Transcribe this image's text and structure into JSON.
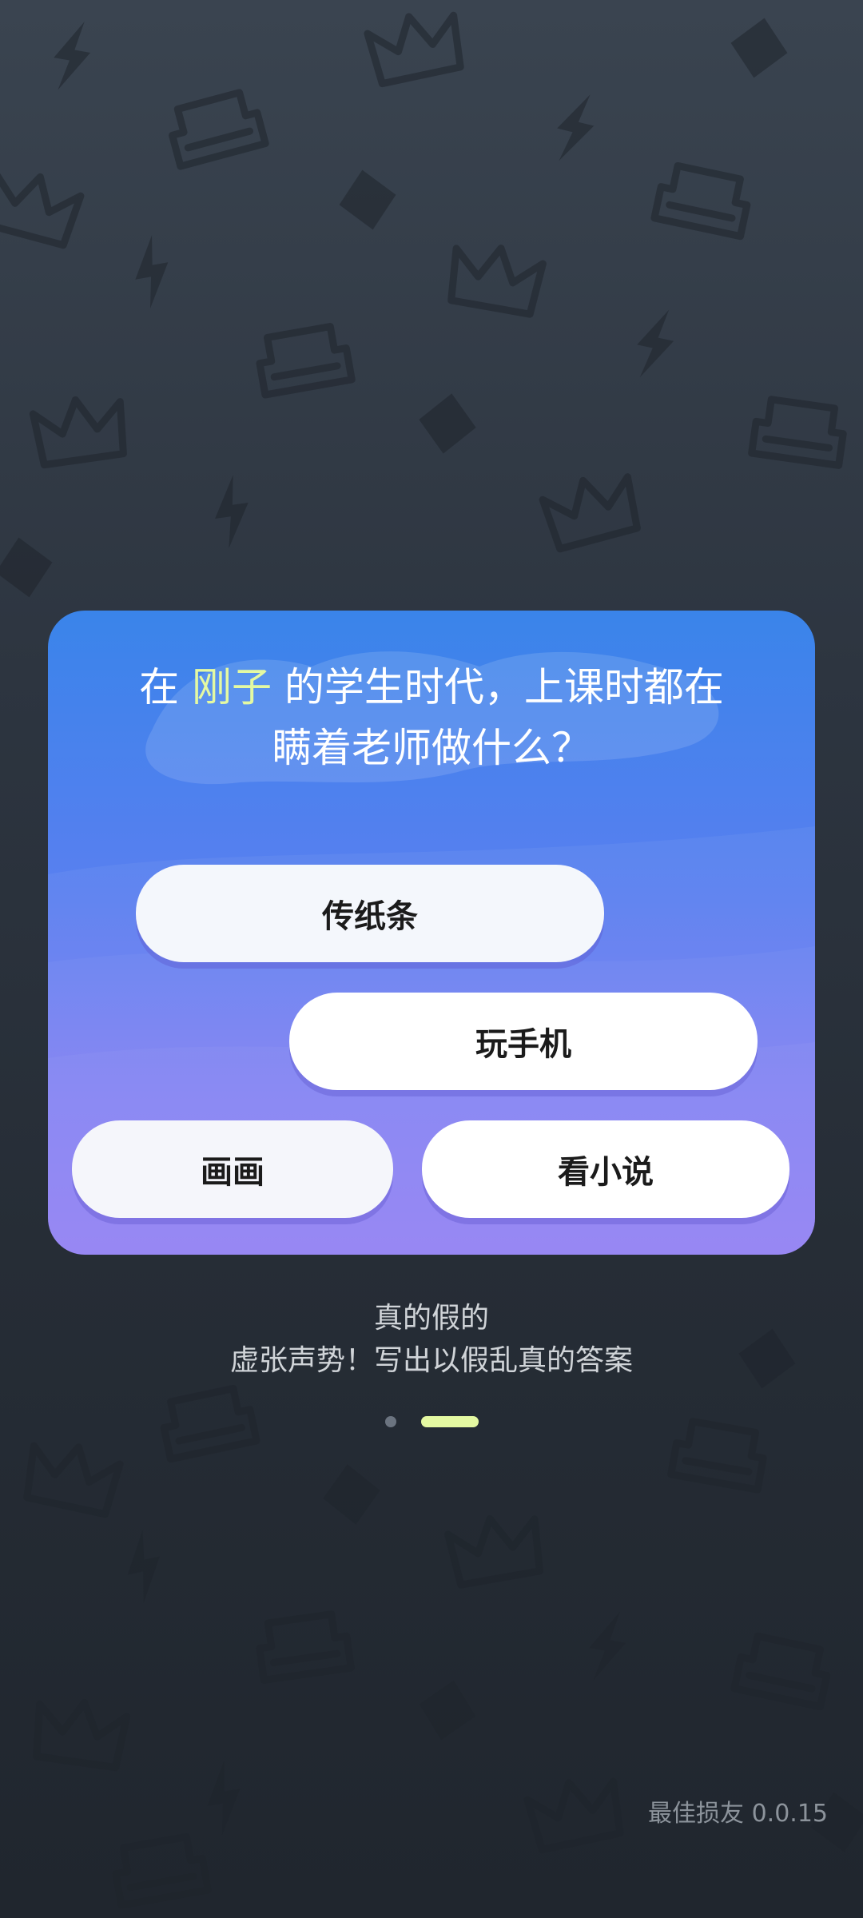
{
  "question": {
    "prefix": "在 ",
    "name": "刚子",
    "suffix": " 的学生时代，上课时都在瞒着老师做什么？"
  },
  "options": [
    "传纸条",
    "玩手机",
    "画画",
    "看小说"
  ],
  "mode": {
    "title": "真的假的",
    "description": "虚张声势！写出以假乱真的答案"
  },
  "pager": {
    "total": 2,
    "active_index": 1,
    "active_color": "#e4f9a2"
  },
  "version": "最佳损友 0.0.15",
  "colors": {
    "card_top": "#3a84ea",
    "card_bottom": "#8a78f3",
    "highlight": "#e4f9a2",
    "background": "#2d3540"
  },
  "icons": [
    "crown-icon",
    "sofa-icon",
    "lightning-icon",
    "diamond-icon"
  ]
}
